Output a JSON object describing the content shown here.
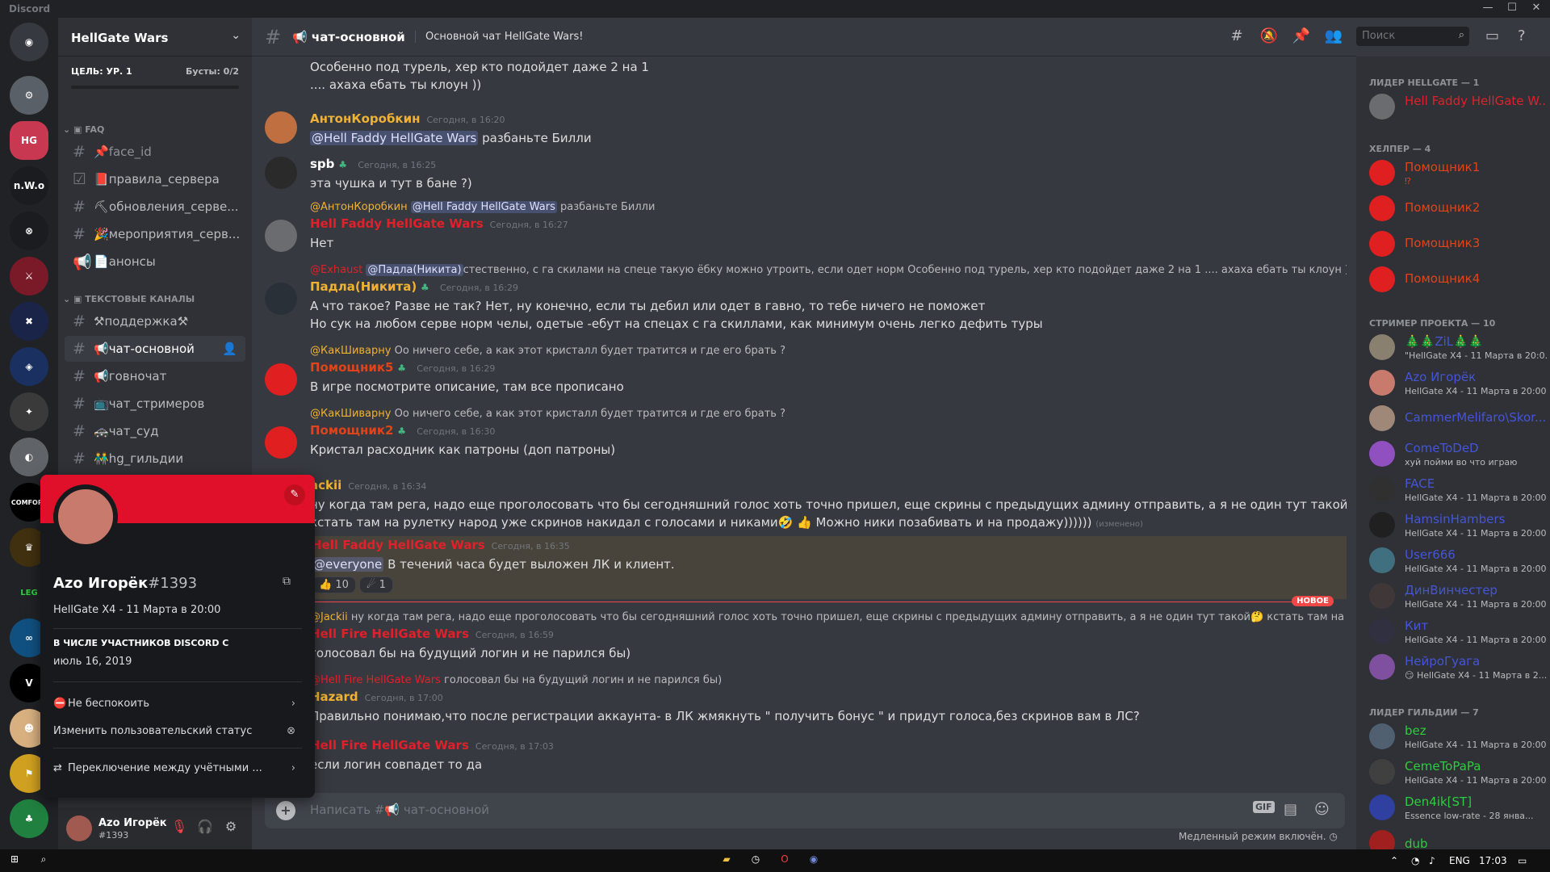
{
  "window": {
    "app_title": "Discord"
  },
  "server": {
    "name": "HellGate Wars",
    "goal": "ЦЕЛЬ: УР. 1",
    "boosts": "Бусты: 0/2"
  },
  "guild_labels": [
    "n.W.o",
    "COMFORT",
    "LEG"
  ],
  "categories": {
    "faq": "FAQ",
    "text": "ТЕКСТОВЫЕ КАНАЛЫ"
  },
  "channels": [
    "face_id",
    "правила_сервера",
    "обновления_серве...",
    "мероприятия_серв...",
    "анонсы",
    "⚒поддержка⚒",
    "чат-основной",
    "говночат",
    "чат_стримеров",
    "чат_суд",
    "hg_гильдии"
  ],
  "header": {
    "channel": "чат-основной",
    "topic": "Основной чат HellGate Wars!",
    "search": "Поиск"
  },
  "messages": {
    "m0_l1": "Особенно под турель, хер кто подойдет даже 2 на 1",
    "m0_l2": ".... ахаха ебать ты клоун ))",
    "m1_name": "АнтонКоробкин",
    "m1_time": "Сегодня, в 16:20",
    "m1_mention": "@Hell Faddy HellGate Wars",
    "m1_text": "разбаньте Билли",
    "m2_name": "spb",
    "m2_time": "Сегодня, в 16:25",
    "m2_text": "эта чушка и тут в бане ?)",
    "m3_reply_user": "@АнтонКоробкин",
    "m3_reply_mention": "@Hell Faddy HellGate Wars",
    "m3_reply_text": "разбаньте Билли",
    "m3_name": "Hell Faddy HellGate Wars",
    "m3_time": "Сегодня, в 16:27",
    "m3_text": "Нет",
    "m4_reply_user": "@Exhaust",
    "m4_reply_mention": "@Падла(Никита)",
    "m4_reply_text": "стественно, с га скилами на спеце такую ёбку можно утроить, если одет норм Особенно под турель, хер кто подойдет даже 2 на 1 .... ахаха ебать ты клоун ))",
    "m4_name": "Падла(Никита)",
    "m4_time": "Сегодня, в 16:29",
    "m4_l1": "А что такое? Разве не так? Нет, ну конечно, если ты дебил или одет в гавно, то тебе ничего не поможет",
    "m4_l2": "Но сук на любом серве норм челы, одетые -ебут на спецах с га скиллами, как минимум очень легко дефить туры",
    "m5_reply_user": "@КакШиварну",
    "m5_reply_text": "Оо ничего себе, а как этот кристалл будет тратится и где его брать ?",
    "m5_name": "Помощник5",
    "m5_time": "Сегодня, в 16:29",
    "m5_text": "В игре посмотрите описание, там все прописано",
    "m6_reply_user": "@КакШиварну",
    "m6_reply_text": "Оо ничего себе, а как этот кристалл будет тратится и где его брать ?",
    "m6_name": "Помощник2",
    "m6_time": "Сегодня, в 16:30",
    "m6_text": "Кристал расходник как патроны (доп патроны)",
    "m7_name": "ackii",
    "m7_time": "Сегодня, в 16:34",
    "m7_l1": "ну когда там рега, надо еще проголосовать что бы сегодняшний голос хоть точно пришел, еще скрины с предыдущих админу отправить, а я не один тут такой🤔",
    "m7_l2": "кстать там на рулетку народ уже скринов накидал с голосами и никами🤣 👍  Можно ники позабивать и на продажу))))))",
    "m7_edited": "(изменено)",
    "m8_name": "Hell Faddy HellGate Wars",
    "m8_time": "Сегодня, в 16:35",
    "m8_mention": "@everyone",
    "m8_text": "В течений часа будет выложен ЛК и клиент.",
    "m8_r1": "👍 10",
    "m8_r2": "☄ 1",
    "new_label": "НОВОЕ",
    "m9_reply_user": "@Jackii",
    "m9_reply_text": "ну когда там рега, надо еще проголосовать что бы сегодняшний голос хоть точно пришел, еще скрины с предыдущих админу отправить, а я не один тут такой🤔 кстать там на рулетку наро",
    "m9_name": "Hell Fire HellGate Wars",
    "m9_time": "Сегодня, в 16:59",
    "m9_text": "голосовал бы на будущий логин и не парился бы)",
    "m10_reply_user": "@Hell Fire HellGate Wars",
    "m10_reply_text": "голосовал бы на будущий логин и не парился бы)",
    "m10_name": "Hazard",
    "m10_time": "Сегодня, в 17:00",
    "m10_text": "Правильно понимаю,что после регистрации аккаунта- в ЛК жмякнуть \" получить  бонус \" и придут голоса,без скринов вам в ЛС?",
    "m11_name": "Hell Fire HellGate Wars",
    "m11_time": "Сегодня, в 17:03",
    "m11_text": "если логин совпадет то да"
  },
  "composer": {
    "placeholder": "Написать #📢 чат-основной",
    "gif": "GIF",
    "slow": "Медленный режим включён."
  },
  "user": {
    "name": "Azo Игорёк",
    "tag": "#1393"
  },
  "popout": {
    "username": "Azo Игорёк",
    "discriminator": "#1393",
    "custom_status": "HellGate X4 - 11 Марта в 20:00",
    "since_label": "В ЧИСЛЕ УЧАСТНИКОВ DISCORD С",
    "since_date": "июль 16, 2019",
    "status": "Не беспокоить",
    "change_status": "Изменить пользовательский статус",
    "switch_accounts": "Переключение между учётными ..."
  },
  "members": {
    "cat1": "ЛИДЕР HELLGATE — 1",
    "cat2": "ХЕЛПЕР — 4",
    "cat3": "СТРИМЕР ПРОЕКТА — 10",
    "cat4": "ЛИДЕР ГИЛЬДИИ — 7",
    "list": [
      {
        "name": "Hell Faddy HellGate W...",
        "status": ""
      },
      {
        "name": "Помощник1",
        "status": "⁉"
      },
      {
        "name": "Помощник2",
        "status": ""
      },
      {
        "name": "Помощник3",
        "status": ""
      },
      {
        "name": "Помощник4",
        "status": ""
      },
      {
        "name": "🎄🎄ZiL🎄🎄",
        "status": "\"HellGate X4 - 11 Марта в 20:0..."
      },
      {
        "name": "Azo Игорёк",
        "status": "HellGate X4 - 11 Марта в 20:00"
      },
      {
        "name": "CammerMelifaro\\Skor...",
        "status": ""
      },
      {
        "name": "ComeToDeD",
        "status": "хуй пойми во что играю"
      },
      {
        "name": "FACE",
        "status": "HellGate X4 - 11 Марта в 20:00!"
      },
      {
        "name": "HamsinHambers",
        "status": "HellGate X4 - 11 Марта в 20:00!"
      },
      {
        "name": "User666",
        "status": "HellGate X4 - 11 Марта в 20:00!"
      },
      {
        "name": "ДинВинчестер",
        "status": "HellGate X4 - 11 Марта в 20:00!"
      },
      {
        "name": "Кит",
        "status": "HellGate X4 - 11 Марта в 20:00!"
      },
      {
        "name": "НейроГуага",
        "status": "😏 HellGate X4 - 11 Марта в 2..."
      },
      {
        "name": "bez",
        "status": "HellGate X4 - 11 Марта в 20:00"
      },
      {
        "name": "CemeToPaPa",
        "status": "HellGate X4 - 11 Марта в 20:00"
      },
      {
        "name": "Den4ik[ST]",
        "status": "Essence low-rate - 28 янва..."
      },
      {
        "name": "dub",
        "status": ""
      }
    ]
  },
  "taskbar": {
    "lang": "ENG",
    "time": "17:03"
  },
  "colors": {
    "red_role": "#e0202a",
    "helper": "#e04418",
    "streamer": "#4555d8",
    "guild": "#2ecc40",
    "yellow": "#f0b232"
  }
}
